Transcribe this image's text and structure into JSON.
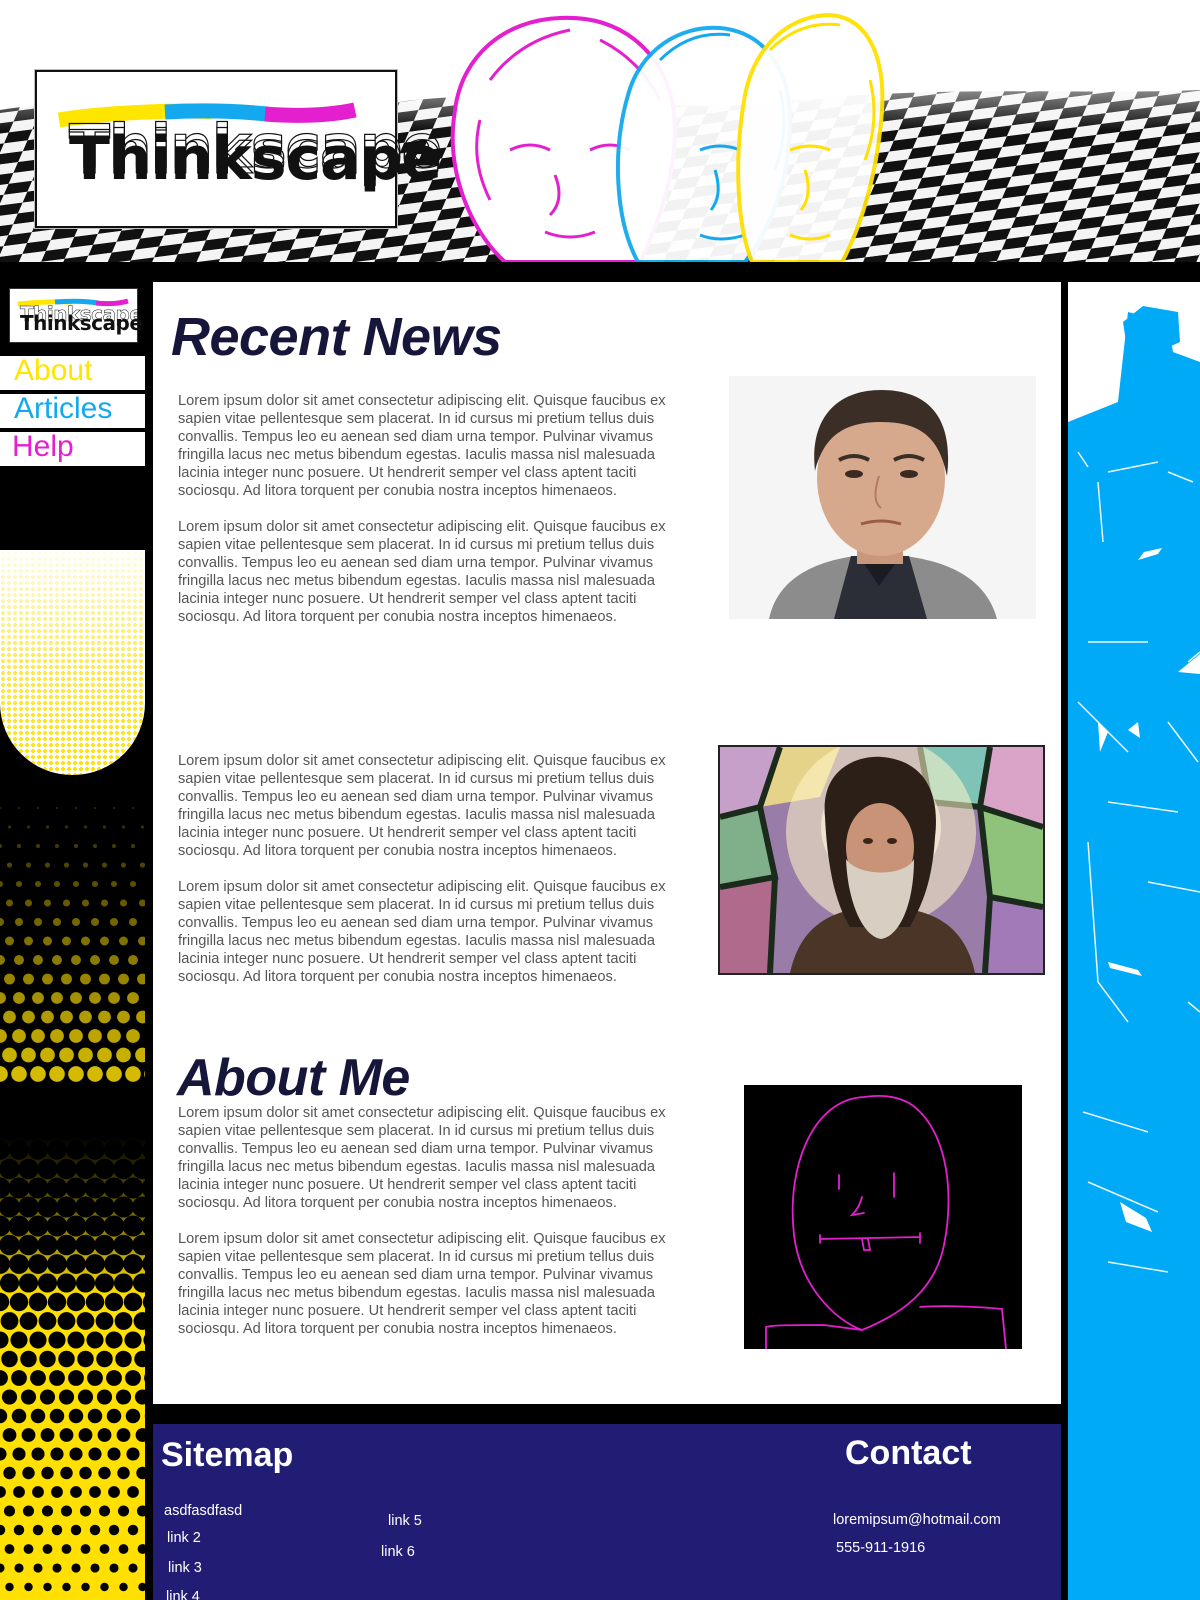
{
  "brand": {
    "logo_text": "Thinkscape"
  },
  "nav": {
    "items": [
      {
        "label": "About",
        "color": "#ffe600"
      },
      {
        "label": "Articles",
        "color": "#14a9ee"
      },
      {
        "label": "Help",
        "color": "#e41fcf"
      }
    ]
  },
  "colors": {
    "magenta": "#e41fcf",
    "cyan": "#14a9ee",
    "yellow": "#ffe600",
    "footer_bg": "#211d75",
    "title_text": "#16163a"
  },
  "main": {
    "news_title": "Recent News",
    "about_title": "About Me",
    "paragraph_text": "Lorem ipsum dolor sit amet consectetur adipiscing elit. Quisque faucibus ex sapien vitae pellentesque sem placerat. In id cursus mi pretium tellus duis convallis. Tempus leo eu aenean sed diam urna tempor. Pulvinar vivamus fringilla lacus nec metus bibendum egestas. Iaculis massa nisl malesuada lacinia integer nunc posuere. Ut hendrerit semper vel class aptent taciti sociosqu. Ad litora torquent per conubia nostra inceptos himenaeos."
  },
  "footer": {
    "sitemap_title": "Sitemap",
    "contact_title": "Contact",
    "links": [
      "asdfasdfasd",
      "link 2",
      "link 3",
      "link 4",
      "link 5",
      "link 6"
    ],
    "email": "loremipsum@hotmail.com",
    "phone": "555-911-1916"
  }
}
